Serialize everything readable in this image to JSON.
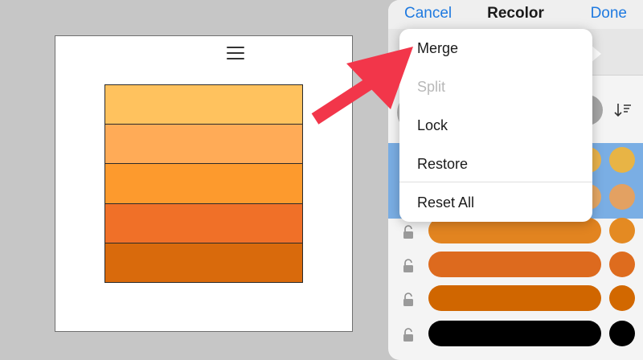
{
  "header": {
    "cancel_label": "Cancel",
    "title": "Recolor",
    "done_label": "Done"
  },
  "artboard": {
    "swatches": [
      "#ffc25e",
      "#ffab57",
      "#fd9a2d",
      "#f07028",
      "#d96a0c"
    ]
  },
  "menu": {
    "items": [
      {
        "label": "Merge",
        "enabled": true
      },
      {
        "label": "Split",
        "enabled": false
      },
      {
        "label": "Lock",
        "enabled": true
      },
      {
        "label": "Restore",
        "enabled": true
      },
      {
        "label": "Reset All",
        "enabled": true
      }
    ]
  },
  "color_rows": [
    {
      "pill": "#e9b24a",
      "dot": "#e8b445",
      "selected": true
    },
    {
      "pill": "#e5a764",
      "dot": "#e3a162",
      "selected": true
    },
    {
      "pill": "#e28420",
      "dot": "#e48a22",
      "selected": false
    },
    {
      "pill": "#dd6a1e",
      "dot": "#de6c1e",
      "selected": false
    },
    {
      "pill": "#d06600",
      "dot": "#d26800",
      "selected": false
    },
    {
      "pill": "#000000",
      "dot": "#000000",
      "selected": false
    }
  ],
  "colors": {
    "accent": "#1f7ae0",
    "annotation_arrow": "#f2364a",
    "selection": "#7aaee4"
  },
  "icons": [
    "menu-icon",
    "sort-icon",
    "lock-icon"
  ]
}
